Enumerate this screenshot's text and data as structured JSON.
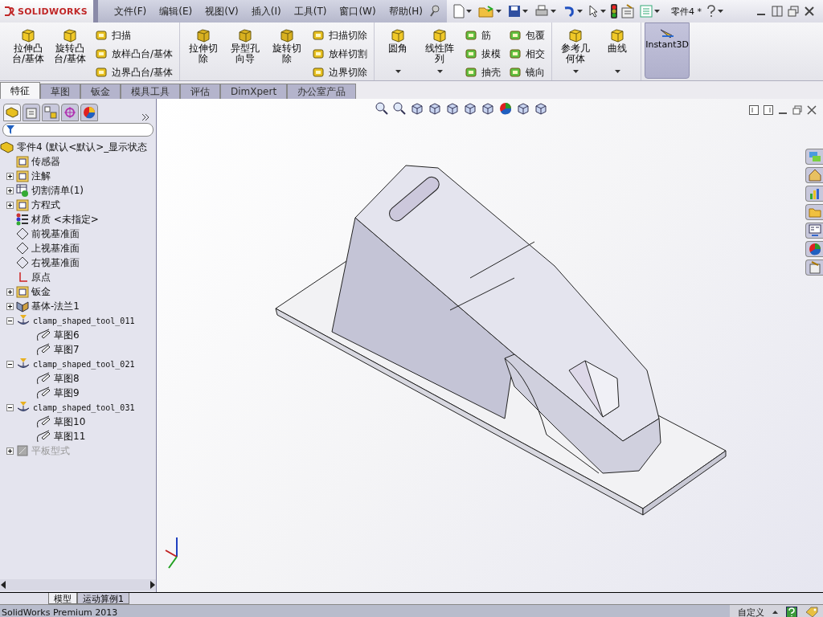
{
  "title_bar": {
    "logo": "SOLIDWORKS",
    "menu": [
      "文件(F)",
      "编辑(E)",
      "视图(V)",
      "插入(I)",
      "工具(T)",
      "窗口(W)",
      "帮助(H)"
    ],
    "document": "零件4 *"
  },
  "ribbon": {
    "groups": [
      {
        "large": [
          {
            "label": "拉伸凸台/基体",
            "dropdown": false
          },
          {
            "label": "旋转凸台/基体",
            "dropdown": false
          }
        ],
        "small_columns": [
          [
            "扫描",
            "放样凸台/基体",
            "边界凸台/基体"
          ]
        ]
      },
      {
        "large": [
          {
            "label": "拉伸切除",
            "dropdown": false
          },
          {
            "label": "异型孔向导",
            "dropdown": false
          },
          {
            "label": "旋转切除",
            "dropdown": false
          }
        ],
        "small_columns": [
          [
            "扫描切除",
            "放样切割",
            "边界切除"
          ]
        ]
      },
      {
        "large": [
          {
            "label": "圆角",
            "dropdown": true
          },
          {
            "label": "线性阵列",
            "dropdown": true
          }
        ],
        "small_columns": [
          [
            "筋",
            "拔模",
            "抽壳"
          ],
          [
            "包覆",
            "相交",
            "镜向"
          ]
        ]
      },
      {
        "large": [
          {
            "label": "参考几何体",
            "dropdown": true
          },
          {
            "label": "曲线",
            "dropdown": true
          }
        ]
      }
    ],
    "toggle": {
      "label": "Instant3D",
      "on": true
    }
  },
  "tabs": [
    {
      "label": "特征",
      "selected": true
    },
    {
      "label": "草图",
      "selected": false
    },
    {
      "label": "钣金",
      "selected": false
    },
    {
      "label": "模具工具",
      "selected": false
    },
    {
      "label": "评估",
      "selected": false
    },
    {
      "label": "DimXpert",
      "selected": false
    },
    {
      "label": "办公室产品",
      "selected": false
    }
  ],
  "panel_tabs": [
    {
      "selected": true
    },
    {
      "selected": false
    },
    {
      "selected": false
    },
    {
      "selected": false
    },
    {
      "selected": false
    }
  ],
  "tree": [
    {
      "label": "零件4  (默认<默认>_显示状态",
      "kind": "part",
      "suppressed": false,
      "children": [
        {
          "label": "传感器",
          "kind": "sensor",
          "suppressed": false
        },
        {
          "label": "注解",
          "kind": "annotation",
          "suppressed": false,
          "expanded": false
        },
        {
          "label": "切割清单(1)",
          "kind": "cutlist",
          "suppressed": false,
          "expanded": false
        },
        {
          "label": "方程式",
          "kind": "equation",
          "suppressed": false,
          "expanded": false
        },
        {
          "label": "材质 <未指定>",
          "kind": "material",
          "suppressed": false
        },
        {
          "label": "前视基准面",
          "kind": "plane",
          "suppressed": false
        },
        {
          "label": "上视基准面",
          "kind": "plane",
          "suppressed": false
        },
        {
          "label": "右视基准面",
          "kind": "plane",
          "suppressed": false
        },
        {
          "label": "原点",
          "kind": "origin",
          "suppressed": false
        },
        {
          "label": "钣金",
          "kind": "sheetmetal",
          "suppressed": false,
          "expanded": false
        },
        {
          "label": "基体-法兰1",
          "kind": "flange",
          "suppressed": false,
          "expanded": false
        },
        {
          "label": "clamp_shaped_tool_011",
          "kind": "formtool",
          "suppressed": false,
          "expanded": true,
          "children": [
            {
              "label": "草图6",
              "kind": "sketch",
              "suppressed": false
            },
            {
              "label": "草图7",
              "kind": "sketch",
              "suppressed": false
            }
          ]
        },
        {
          "label": "clamp_shaped_tool_021",
          "kind": "formtool",
          "suppressed": false,
          "expanded": true,
          "children": [
            {
              "label": "草图8",
              "kind": "sketch",
              "suppressed": false
            },
            {
              "label": "草图9",
              "kind": "sketch",
              "suppressed": false
            }
          ]
        },
        {
          "label": "clamp_shaped_tool_031",
          "kind": "formtool",
          "suppressed": false,
          "expanded": true,
          "children": [
            {
              "label": "草图10",
              "kind": "sketch",
              "suppressed": false
            },
            {
              "label": "草图11",
              "kind": "sketch",
              "suppressed": false
            }
          ]
        },
        {
          "label": "平板型式",
          "kind": "flatpattern",
          "suppressed": true,
          "expanded": false
        }
      ]
    }
  ],
  "bottom_tabs": [
    {
      "label": "模型",
      "selected": true
    },
    {
      "label": "运动算例1",
      "selected": false
    }
  ],
  "status_bar": {
    "product": "SolidWorks Premium 2013",
    "units": "自定义"
  }
}
